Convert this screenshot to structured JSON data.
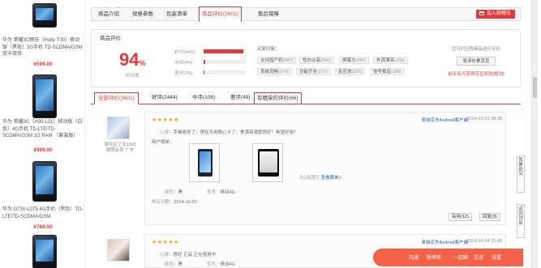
{
  "left_products": [
    {
      "name": "华为 荣耀3C畅玩（Holly-T00）移动版（黑色）3G手机 TD-SCDMA/GSM 双卡双待",
      "price": "¥599.00"
    },
    {
      "name": "华为 荣耀3C（H30-L01）移动版（白色）4G手机 TD-LTE/TD-SCDMA/GSM 1G RAM （套装版）",
      "price": "¥999.00"
    },
    {
      "name": "华为 G730-L075 4G手机（黑色）TD-LTE/TD-SCDMA/GSM",
      "price": "¥788.00"
    }
  ],
  "tabs": [
    "商品介绍",
    "规格参数",
    "包装清单",
    "商品评价",
    "售后保障"
  ],
  "active_tab_count": "(2601)",
  "add_to_cart": "加入购物车",
  "review_heading": "商品评价",
  "good_rate": "94",
  "good_rate_unit": "%",
  "good_rate_label": "好评度",
  "rates": [
    {
      "label": "好评(94%)",
      "value": 0.94
    },
    {
      "label": "中评(4%)",
      "value": 0.04
    },
    {
      "label": "差评(2%)",
      "value": 0.02
    }
  ],
  "impression_label": "买家印象：",
  "tags": [
    {
      "name": "支持国产机",
      "count": "(687)"
    },
    {
      "name": "性价比高",
      "count": "(596)"
    },
    {
      "name": "屏幕大",
      "count": "(365)"
    },
    {
      "name": "外观漂亮",
      "count": "(299)"
    },
    {
      "name": "系统流畅",
      "count": "(279)"
    },
    {
      "name": "功能齐全",
      "count": "(275)"
    },
    {
      "name": "反应快",
      "count": "(225)"
    },
    {
      "name": "信号稳定",
      "count": "(195)"
    }
  ],
  "side_question": "您可对已购商品进行评价",
  "write_review": "发评价拿京豆",
  "side_link": "前五名可获得京豆奖励[规则]",
  "filter_tabs": [
    "全部评价(2601)",
    "好评(2444)",
    "中评(108)",
    "差评(49)",
    "有晒单的评价(66)"
  ],
  "reviews": [
    {
      "stars": "★★★★★",
      "user": "清风且了无1992",
      "level": "铜牌会员 广东",
      "source": "来自京东Android客户端",
      "date": "2014-10-22 08:38",
      "heart_label": "心得：",
      "heart": "手機收到了：現在不用擔心卡了：美漂亮速度很好！希望好用！",
      "shots_label": "用户晒单：",
      "shots_count": "共2张图片",
      "shots_link": "查看晒单>",
      "color_label": "颜色：",
      "color": "黑",
      "type_label": "型号：",
      "type": "移动4G",
      "buy_date_label": "购买日期：",
      "buy_date": "2014-10-20",
      "useful": "有用(12)",
      "reply": "回复(9)"
    },
    {
      "stars": "★★★★★",
      "source": "来自京东Android客户端",
      "date": "2014-10-14 15:49",
      "heart_label": "心得：",
      "heart": "很好 正品 正在使用中",
      "color_label": "颜色：",
      "color": "黑",
      "type_label": "型号：",
      "type": "移动4G"
    }
  ],
  "side_tools": [
    "我要提问",
    "返回顶部"
  ],
  "bottom_bar": [
    "沟通",
    "微博客",
    "一起聊",
    "足迹",
    "设置"
  ]
}
